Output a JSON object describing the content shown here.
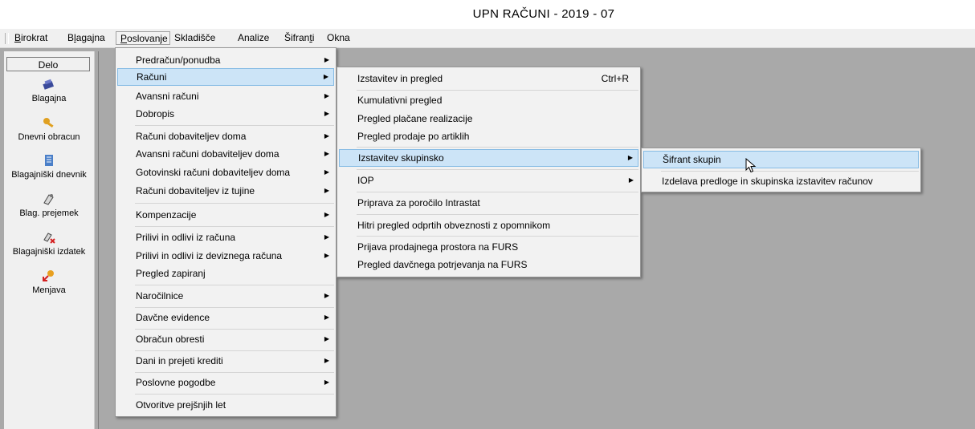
{
  "window": {
    "title": "UPN RAČUNI - 2019 - 07"
  },
  "menubar": {
    "items": [
      {
        "first": "B",
        "rest": "irokrat"
      },
      {
        "pre": "B",
        "u": "l",
        "rest": "agajna"
      },
      {
        "first": "P",
        "rest": "oslovanje"
      },
      {
        "label": "Skladišče"
      },
      {
        "label": "Analize"
      },
      {
        "pre": "Šifran",
        "u": "t",
        "rest": "i"
      },
      {
        "label": "Okna"
      }
    ]
  },
  "sidebar": {
    "header": "Delo",
    "items": [
      {
        "label": "Blagajna",
        "icon": "cash-register-icon"
      },
      {
        "label": "Dnevni obracun",
        "icon": "key-icon"
      },
      {
        "label": "Blagajniški dnevnik",
        "icon": "journal-icon"
      },
      {
        "label": "Blag. prejemek",
        "icon": "receipt-icon"
      },
      {
        "label": "Blagajniški izdatek",
        "icon": "expense-icon"
      },
      {
        "label": "Menjava",
        "icon": "exchange-icon"
      }
    ]
  },
  "menu_poslovanje": {
    "items": [
      "Predračun/ponudba",
      "Računi",
      "Avansni računi",
      "Dobropis",
      "Računi dobaviteljev doma",
      "Avansni računi dobaviteljev doma",
      "Gotovinski računi dobaviteljev doma",
      "Računi dobaviteljev iz tujine",
      "Kompenzacije",
      "Prilivi in odlivi iz računa",
      "Prilivi in odlivi iz deviznega računa",
      "Pregled zapiranj",
      "Naročilnice",
      "Davčne evidence",
      "Obračun obresti",
      "Dani in prejeti krediti",
      "Poslovne pogodbe",
      "Otvoritve prejšnjih let"
    ]
  },
  "menu_racuni": {
    "items": [
      "Izstavitev in pregled",
      "Kumulativni pregled",
      "Pregled plačane realizacije",
      "Pregled prodaje po artiklih",
      "Izstavitev skupinsko",
      "IOP",
      "Priprava za poročilo Intrastat",
      "Hitri pregled odprtih obveznosti z opomnikom",
      "Prijava prodajnega prostora na FURS",
      "Pregled davčnega potrjevanja na FURS"
    ],
    "shortcut": "Ctrl+R"
  },
  "menu_skupinsko": {
    "items": [
      "Šifrant skupin",
      "Izdelava predloge in skupinska izstavitev računov"
    ]
  }
}
